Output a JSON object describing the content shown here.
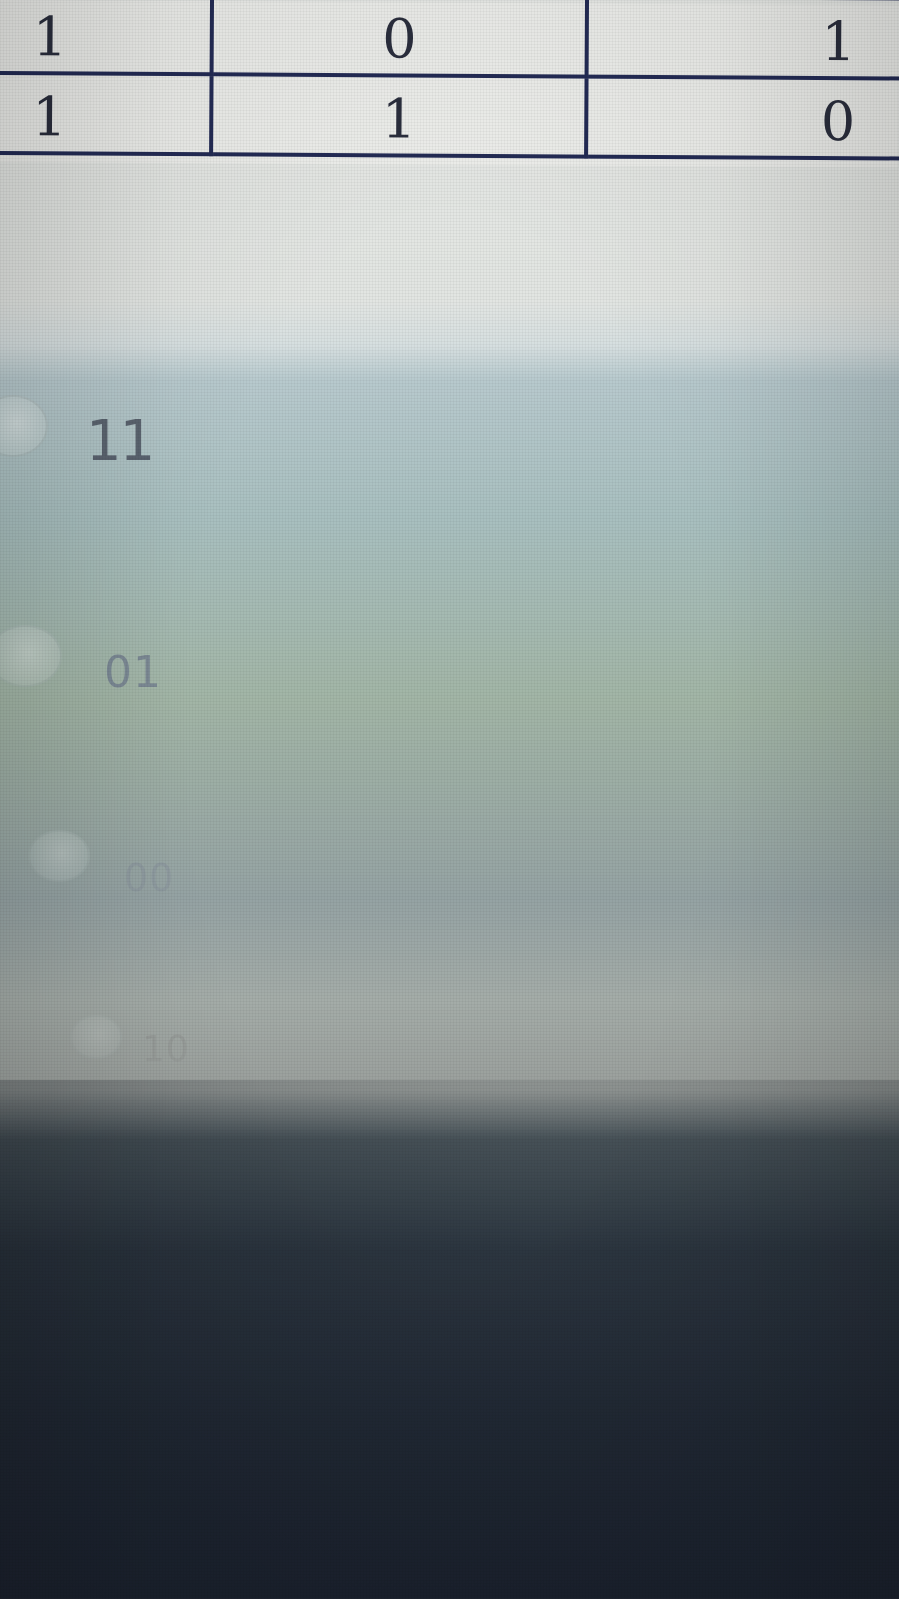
{
  "truth_table": {
    "rows": [
      [
        "1",
        "0",
        "1"
      ],
      [
        "1",
        "1",
        "0"
      ]
    ]
  },
  "options": [
    {
      "label": "11"
    },
    {
      "label": "01"
    },
    {
      "label": "00"
    },
    {
      "label": "10"
    }
  ],
  "colors": {
    "table_border": "#232b55",
    "table_text": "#2a2e3d",
    "option_text": "#5b6470",
    "panel_bg": "#b7c9cd"
  }
}
